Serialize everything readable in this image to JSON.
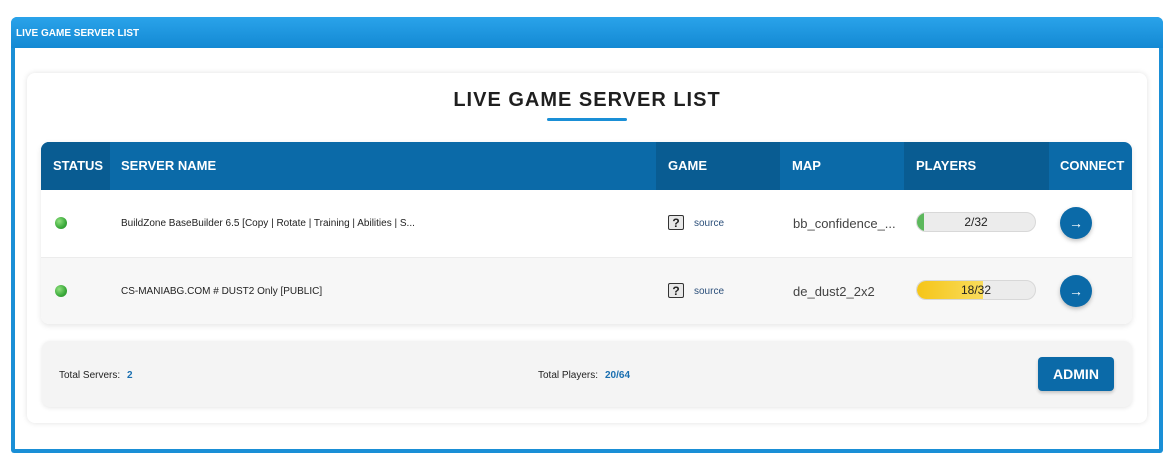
{
  "window": {
    "title": "LIVE GAME SERVER LIST"
  },
  "page": {
    "heading": "LIVE GAME SERVER LIST"
  },
  "table": {
    "columns": [
      "STATUS",
      "SERVER NAME",
      "GAME",
      "MAP",
      "PLAYERS",
      "CONNECT"
    ],
    "rows": [
      {
        "status": "online",
        "server_name": "BuildZone BaseBuilder 6.5 [Copy | Rotate | Training | Abilities | S...",
        "game_icon": "question-mark-icon",
        "game": "source",
        "map": "bb_confidence_...",
        "players": "2/32",
        "players_fraction": 0.0625,
        "players_color": "#5cb85c",
        "connect": "→"
      },
      {
        "status": "online",
        "server_name": "CS-MANIABG.COM # DUST2 Only [PUBLIC]",
        "game_icon": "question-mark-icon",
        "game": "source",
        "map": "de_dust2_2x2",
        "players": "18/32",
        "players_fraction": 0.5625,
        "players_color": "#f5c518",
        "connect": "→"
      }
    ]
  },
  "footer": {
    "total_servers_label": "Total Servers:",
    "total_servers_value": "2",
    "total_players_label": "Total Players:",
    "total_players_value": "20/64",
    "admin_label": "ADMIN"
  },
  "colors": {
    "accent": "#0b6aa8",
    "window_blue": "#1a8fd6",
    "online": "#3aa93a"
  }
}
